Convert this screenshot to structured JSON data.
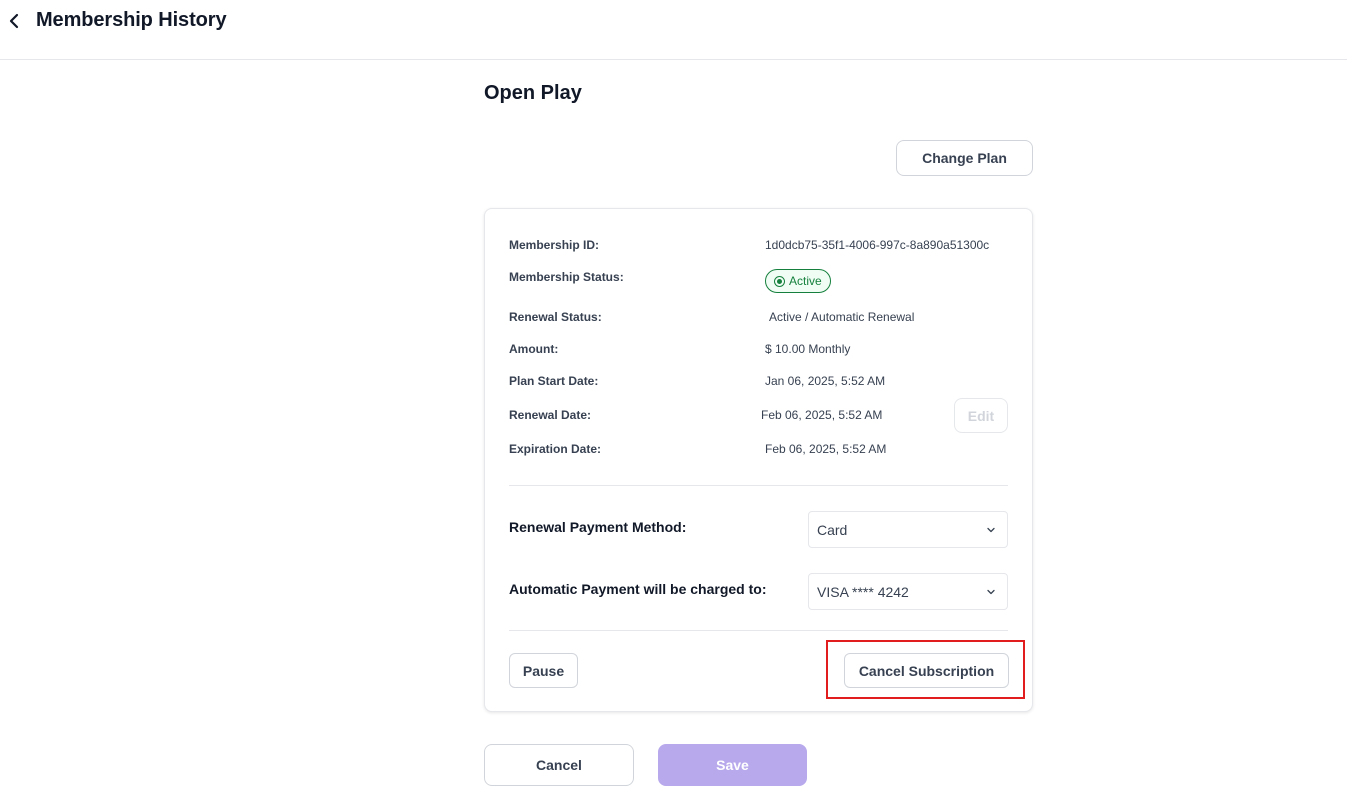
{
  "header": {
    "back_icon": "chevron-left-icon",
    "title": "Membership History"
  },
  "plan": {
    "name": "Open Play",
    "change_plan_label": "Change Plan"
  },
  "details": {
    "membership_id": {
      "label": "Membership ID:",
      "value": "1d0dcb75-35f1-4006-997c-8a890a51300c"
    },
    "membership_status": {
      "label": "Membership Status:",
      "value": "Active",
      "color": "#15803d"
    },
    "renewal_status": {
      "label": "Renewal Status:",
      "value": "Active / Automatic Renewal"
    },
    "amount": {
      "label": "Amount:",
      "value": "$ 10.00 Monthly"
    },
    "plan_start_date": {
      "label": "Plan Start Date:",
      "value": "Jan 06, 2025, 5:52 AM"
    },
    "renewal_date": {
      "label": "Renewal Date:",
      "value": "Feb 06, 2025, 5:52 AM"
    },
    "expiration_date": {
      "label": "Expiration Date:",
      "value": "Feb 06, 2025, 5:52 AM"
    },
    "edit_label": "Edit"
  },
  "payment": {
    "method_label": "Renewal Payment Method:",
    "method_value": "Card",
    "charged_to_label": "Automatic Payment will be charged to:",
    "charged_to_value": "VISA **** 4242"
  },
  "actions": {
    "pause_label": "Pause",
    "cancel_subscription_label": "Cancel Subscription",
    "highlight_color": "#e11d1d"
  },
  "footer": {
    "cancel_label": "Cancel",
    "save_label": "Save",
    "save_color": "#b8a9ec"
  }
}
